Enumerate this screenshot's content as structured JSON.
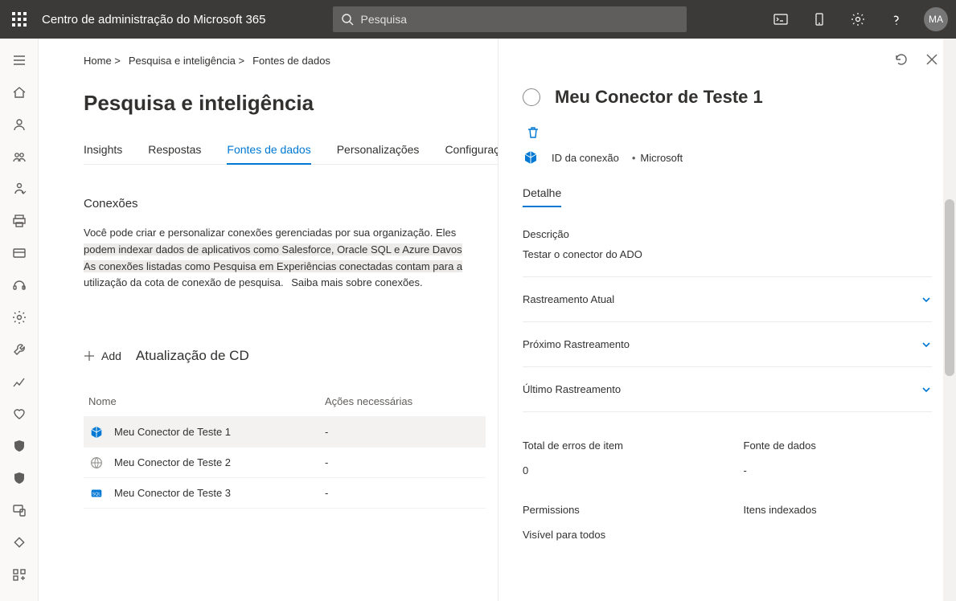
{
  "header": {
    "app_title": "Centro de administração do Microsoft 365",
    "search_placeholder": "Pesquisa",
    "avatar_initials": "MA"
  },
  "breadcrumb": {
    "items": [
      "Home >",
      "Pesquisa e inteligência >",
      "Fontes de dados"
    ]
  },
  "page": {
    "title": "Pesquisa e inteligência"
  },
  "tabs": {
    "items": [
      {
        "label": "Insights"
      },
      {
        "label": "Respostas"
      },
      {
        "label": "Fontes de dados",
        "active": true
      },
      {
        "label": "Personalizações"
      },
      {
        "label": "Configurações"
      }
    ]
  },
  "connections": {
    "heading": "Conexões",
    "desc_plain_start": "Você pode criar e personalizar conexões gerenciadas por sua organização. Eles ",
    "desc_hl1": "podem indexar dados de aplicativos como Salesforce, Oracle SQL e Azure Davos",
    "desc_hl2": "As conexões listadas como Pesquisa em Experiências conectadas contam para a",
    "desc_plain_end": "utilização da cota de conexão de pesquisa.",
    "learn_more": "Saiba mais sobre conexões.",
    "add_label": "Add",
    "cd_update_label": "Atualização de CD",
    "grid": {
      "col_name": "Nome",
      "col_actions": "Ações necessárias",
      "rows": [
        {
          "name": "Meu Conector de Teste 1",
          "actions": "-",
          "icon": "cube"
        },
        {
          "name": "Meu Conector de Teste 2",
          "actions": "-",
          "icon": "globe"
        },
        {
          "name": "Meu Conector de Teste 3",
          "actions": "-",
          "icon": "sql"
        }
      ]
    }
  },
  "panel": {
    "title": "Meu Conector de Teste 1",
    "conn_id_label": "ID da conexão",
    "vendor": "Microsoft",
    "tab": "Detalhe",
    "desc_label": "Descrição",
    "desc_value": "Testar o conector do ADO",
    "accordion": [
      "Rastreamento Atual",
      "Próximo Rastreamento",
      "Último Rastreamento"
    ],
    "stats": {
      "errors_label": "Total de erros de item",
      "errors_value": "0",
      "source_label": "Fonte de dados",
      "source_value": "-",
      "perm_label": "Permissions",
      "perm_value": "Visível para todos",
      "indexed_label": "Itens indexados",
      "indexed_value": ""
    }
  }
}
